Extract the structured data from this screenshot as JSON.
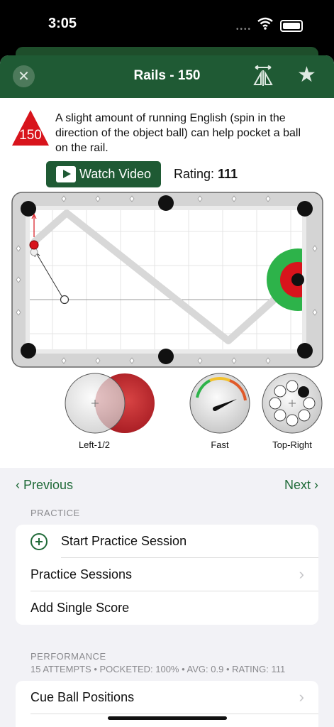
{
  "status": {
    "time": "3:05"
  },
  "nav": {
    "title": "Rails - 150",
    "close": "✕",
    "star": "★"
  },
  "drill": {
    "number": "150",
    "description": "A slight amount of running English (spin in the direction of the object ball) can help pocket a ball on the rail.",
    "watch_label": "Watch Video",
    "rating_label": "Rating:",
    "rating_value": "111"
  },
  "indicators": {
    "aim_label": "Left-1/2",
    "speed_label": "Fast",
    "spin_label": "Top-Right"
  },
  "navigation": {
    "previous": "‹ Previous",
    "next": "Next ›"
  },
  "practice": {
    "header": "PRACTICE",
    "items": [
      "Start Practice Session",
      "Practice Sessions",
      "Add Single Score"
    ]
  },
  "performance": {
    "header": "PERFORMANCE",
    "summary": "15 ATTEMPTS • POCKETED: 100% • AVG: 0.9 • RATING: 111",
    "items": [
      "Cue Ball Positions"
    ]
  },
  "colors": {
    "brand": "#1f5a34",
    "accent": "#1f6a38",
    "target_green": "#2db34a",
    "target_red": "#d8141c"
  }
}
